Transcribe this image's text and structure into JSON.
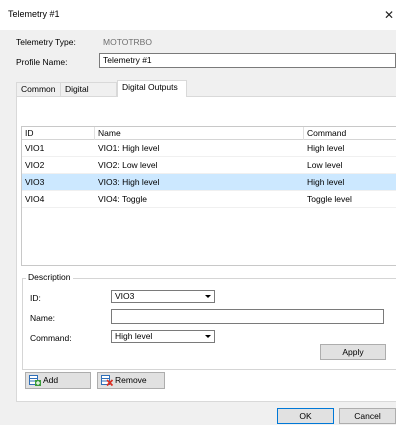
{
  "window": {
    "title": "Telemetry #1",
    "close_glyph": "✕"
  },
  "form": {
    "telemetry_type_label": "Telemetry Type:",
    "telemetry_type_value": "MOTOTRBO",
    "profile_name_label": "Profile Name:",
    "profile_name_value": "Telemetry #1"
  },
  "tabs": [
    {
      "label": "Common",
      "active": false
    },
    {
      "label": "Digital Inputs",
      "active": false
    },
    {
      "label": "Digital Outputs",
      "active": true
    }
  ],
  "table": {
    "columns": [
      "ID",
      "Name",
      "Command"
    ],
    "rows": [
      {
        "id": "VIO1",
        "name": "VIO1: High level",
        "command": "High level",
        "selected": false
      },
      {
        "id": "VIO2",
        "name": "VIO2: Low level",
        "command": "Low level",
        "selected": false
      },
      {
        "id": "VIO3",
        "name": "VIO3: High level",
        "command": "High level",
        "selected": true
      },
      {
        "id": "VIO4",
        "name": "VIO4: Toggle",
        "command": "Toggle level",
        "selected": false
      }
    ]
  },
  "description": {
    "legend": "Description",
    "id_label": "ID:",
    "id_value": "VIO3",
    "name_label": "Name:",
    "name_value": "",
    "command_label": "Command:",
    "command_value": "High level",
    "apply_label": "Apply"
  },
  "actions": {
    "add_label": "Add",
    "remove_label": "Remove",
    "add_icon": "add-row-icon",
    "remove_icon": "remove-row-icon"
  },
  "footer": {
    "ok_label": "OK",
    "cancel_label": "Cancel"
  },
  "colors": {
    "selection": "#cce8ff",
    "icon_green": "#3a9b3a",
    "icon_red": "#d93025",
    "icon_blue": "#2f6fb8"
  }
}
